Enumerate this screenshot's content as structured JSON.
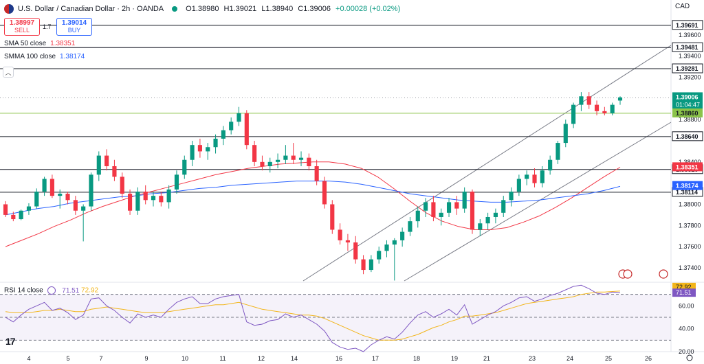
{
  "header": {
    "symbol": "U.S. Dollar / Canadian Dollar · 2h · OANDA",
    "open": "O1.38980",
    "high": "H1.39021",
    "low": "L1.38940",
    "close": "C1.39006",
    "change": "+0.00028 (+0.02%)"
  },
  "trade": {
    "sell_price": "1.38997",
    "sell_label": "SELL",
    "spread": "1.7",
    "buy_price": "1.39014",
    "buy_label": "BUY"
  },
  "indicators": {
    "sma_label": "SMA 50 close",
    "sma_value": "1.38351",
    "smma_label": "SMMA 100 close",
    "smma_value": "1.38174"
  },
  "currency": "CAD",
  "rsi": {
    "label": "RSI 14 close",
    "value": "71.51",
    "ma_value": "72.92"
  },
  "colors": {
    "up": "#089981",
    "down": "#f23645",
    "sma": "#f23645",
    "smma": "#2962ff",
    "rsi": "#7e57c2",
    "rsi_ma": "#f2b51a"
  },
  "chart_data": {
    "type": "candlestick",
    "x_ticks": [
      "4",
      "5",
      "7",
      "9",
      "10",
      "11",
      "12",
      "14",
      "16",
      "17",
      "18",
      "19",
      "21",
      "23",
      "24",
      "25",
      "26"
    ],
    "y_ticks": [
      "1.39600",
      "1.39400",
      "1.39200",
      "1.38800",
      "1.38400",
      "1.38000",
      "1.37800",
      "1.37600",
      "1.37400"
    ],
    "ylim": [
      1.3727,
      1.3993
    ],
    "last_price": "1.39006",
    "countdown": "01:04:47",
    "horizontal_levels": [
      {
        "label": "1.39691",
        "value": 1.39691,
        "color": "#131722"
      },
      {
        "label": "1.39481",
        "value": 1.39481,
        "color": "#131722"
      },
      {
        "label": "1.39281",
        "value": 1.39281,
        "color": "#131722"
      },
      {
        "label": "1.38860",
        "value": 1.3886,
        "color": "#8bc34a"
      },
      {
        "label": "1.38640",
        "value": 1.3864,
        "color": "#131722"
      },
      {
        "label": "1.38329",
        "value": 1.38329,
        "color": "#131722"
      },
      {
        "label": "1.38114",
        "value": 1.38114,
        "color": "#131722"
      }
    ],
    "price_tags": [
      {
        "label": "1.38351",
        "value": 1.38351,
        "color": "#f23645"
      },
      {
        "label": "1.38174",
        "value": 1.38174,
        "color": "#2962ff"
      }
    ],
    "series": [
      {
        "name": "SMA 50 close",
        "values": [
          1.376,
          1.3766,
          1.3772,
          1.3779,
          1.3785,
          1.3792,
          1.3798,
          1.3803,
          1.3808,
          1.3812,
          1.3816,
          1.382,
          1.3824,
          1.3828,
          1.3831,
          1.3834,
          1.3836,
          1.3838,
          1.3839,
          1.384,
          1.384,
          1.3838,
          1.3834,
          1.3826,
          1.3815,
          1.3803,
          1.3792,
          1.3784,
          1.3779,
          1.3776,
          1.3776,
          1.3778,
          1.3783,
          1.3789,
          1.3797,
          1.3806,
          1.3816,
          1.3826,
          1.3835
        ]
      },
      {
        "name": "SMMA 100 close",
        "values": [
          1.379,
          1.3793,
          1.3796,
          1.3798,
          1.3801,
          1.3803,
          1.3805,
          1.3807,
          1.3808,
          1.381,
          1.3811,
          1.3813,
          1.3815,
          1.3816,
          1.3818,
          1.3819,
          1.382,
          1.3821,
          1.3822,
          1.3822,
          1.3822,
          1.3821,
          1.3819,
          1.3816,
          1.3813,
          1.381,
          1.3808,
          1.3806,
          1.3804,
          1.3803,
          1.3802,
          1.3802,
          1.3803,
          1.3804,
          1.3806,
          1.3808,
          1.381,
          1.3813,
          1.3817
        ]
      },
      {
        "name": "USD/CAD",
        "candles": [
          [
            1.38,
            1.3803,
            1.3788,
            1.379
          ],
          [
            1.379,
            1.3793,
            1.3784,
            1.3786
          ],
          [
            1.3786,
            1.3795,
            1.3785,
            1.3794
          ],
          [
            1.3794,
            1.3801,
            1.379,
            1.3798
          ],
          [
            1.3798,
            1.3815,
            1.3796,
            1.3812
          ],
          [
            1.3812,
            1.3826,
            1.3808,
            1.3824
          ],
          [
            1.3824,
            1.3828,
            1.3806,
            1.3808
          ],
          [
            1.3808,
            1.3814,
            1.3796,
            1.381
          ],
          [
            1.381,
            1.3812,
            1.38,
            1.3804
          ],
          [
            1.3804,
            1.3808,
            1.379,
            1.3794
          ],
          [
            1.3794,
            1.38,
            1.3765,
            1.3798
          ],
          [
            1.3798,
            1.383,
            1.3794,
            1.3828
          ],
          [
            1.3828,
            1.385,
            1.3822,
            1.3846
          ],
          [
            1.3846,
            1.3852,
            1.3832,
            1.3836
          ],
          [
            1.3836,
            1.3842,
            1.3822,
            1.3826
          ],
          [
            1.3826,
            1.383,
            1.3806,
            1.381
          ],
          [
            1.381,
            1.3814,
            1.379,
            1.3794
          ],
          [
            1.3794,
            1.3816,
            1.379,
            1.3812
          ],
          [
            1.3812,
            1.3818,
            1.38,
            1.3804
          ],
          [
            1.3804,
            1.3812,
            1.3798,
            1.3808
          ],
          [
            1.3808,
            1.3812,
            1.3798,
            1.3802
          ],
          [
            1.3802,
            1.3818,
            1.3796,
            1.3814
          ],
          [
            1.3814,
            1.3832,
            1.381,
            1.3828
          ],
          [
            1.3828,
            1.3846,
            1.3824,
            1.3842
          ],
          [
            1.3842,
            1.386,
            1.3836,
            1.3856
          ],
          [
            1.3856,
            1.3862,
            1.3844,
            1.385
          ],
          [
            1.385,
            1.3858,
            1.3842,
            1.3854
          ],
          [
            1.3854,
            1.3866,
            1.3848,
            1.3862
          ],
          [
            1.3862,
            1.3874,
            1.3856,
            1.387
          ],
          [
            1.387,
            1.3882,
            1.3866,
            1.3878
          ],
          [
            1.3878,
            1.3892,
            1.3874,
            1.3886
          ],
          [
            1.3886,
            1.3889,
            1.3852,
            1.3856
          ],
          [
            1.3856,
            1.386,
            1.3836,
            1.384
          ],
          [
            1.384,
            1.3846,
            1.3832,
            1.3836
          ],
          [
            1.3836,
            1.3844,
            1.383,
            1.384
          ],
          [
            1.384,
            1.3848,
            1.3834,
            1.3842
          ],
          [
            1.3842,
            1.3856,
            1.3838,
            1.3846
          ],
          [
            1.3846,
            1.3858,
            1.3838,
            1.3842
          ],
          [
            1.3842,
            1.385,
            1.3836,
            1.3844
          ],
          [
            1.3844,
            1.3848,
            1.3832,
            1.3836
          ],
          [
            1.3836,
            1.3842,
            1.3818,
            1.3822
          ],
          [
            1.3822,
            1.3826,
            1.3796,
            1.38
          ],
          [
            1.38,
            1.3804,
            1.3772,
            1.3776
          ],
          [
            1.3776,
            1.3782,
            1.3762,
            1.3766
          ],
          [
            1.3766,
            1.3772,
            1.3756,
            1.3764
          ],
          [
            1.3764,
            1.377,
            1.3744,
            1.3748
          ],
          [
            1.3748,
            1.3752,
            1.3734,
            1.3738
          ],
          [
            1.3738,
            1.3752,
            1.3736,
            1.3748
          ],
          [
            1.3748,
            1.376,
            1.3744,
            1.3756
          ],
          [
            1.3756,
            1.3766,
            1.375,
            1.3762
          ],
          [
            1.3762,
            1.3768,
            1.3728,
            1.3766
          ],
          [
            1.3766,
            1.3778,
            1.376,
            1.3774
          ],
          [
            1.3774,
            1.3788,
            1.377,
            1.3784
          ],
          [
            1.3784,
            1.3798,
            1.3778,
            1.3794
          ],
          [
            1.3794,
            1.3806,
            1.3788,
            1.3802
          ],
          [
            1.3802,
            1.3808,
            1.3784,
            1.3788
          ],
          [
            1.3788,
            1.3796,
            1.378,
            1.3792
          ],
          [
            1.3792,
            1.3806,
            1.3788,
            1.3802
          ],
          [
            1.3802,
            1.3808,
            1.379,
            1.3796
          ],
          [
            1.3796,
            1.3816,
            1.3792,
            1.3812
          ],
          [
            1.3812,
            1.3814,
            1.3772,
            1.3776
          ],
          [
            1.3776,
            1.3786,
            1.377,
            1.3782
          ],
          [
            1.3782,
            1.3792,
            1.3776,
            1.3788
          ],
          [
            1.3788,
            1.3796,
            1.3782,
            1.3792
          ],
          [
            1.3792,
            1.3808,
            1.3788,
            1.3804
          ],
          [
            1.3804,
            1.3816,
            1.3798,
            1.3812
          ],
          [
            1.3812,
            1.3828,
            1.3808,
            1.3824
          ],
          [
            1.3824,
            1.3832,
            1.3818,
            1.3828
          ],
          [
            1.3828,
            1.3834,
            1.3816,
            1.382
          ],
          [
            1.382,
            1.3836,
            1.3816,
            1.3832
          ],
          [
            1.3832,
            1.3846,
            1.3828,
            1.3842
          ],
          [
            1.3842,
            1.386,
            1.3838,
            1.3858
          ],
          [
            1.3858,
            1.388,
            1.3854,
            1.3876
          ],
          [
            1.3876,
            1.3896,
            1.3872,
            1.3894
          ],
          [
            1.3894,
            1.3906,
            1.3888,
            1.3902
          ],
          [
            1.3902,
            1.3906,
            1.389,
            1.3894
          ],
          [
            1.3894,
            1.3898,
            1.3884,
            1.3888
          ],
          [
            1.3888,
            1.3892,
            1.3884,
            1.3886
          ],
          [
            1.3886,
            1.3896,
            1.3884,
            1.3894
          ],
          [
            1.3898,
            1.3902,
            1.3894,
            1.3901
          ]
        ]
      }
    ],
    "rsi": {
      "ylim": [
        20,
        80
      ],
      "levels": [
        70,
        50,
        30
      ],
      "y_ticks": [
        "60.00",
        "40.00",
        "20.00"
      ],
      "values": [
        50,
        46,
        52,
        57,
        60,
        63,
        56,
        58,
        54,
        48,
        52,
        66,
        67,
        60,
        56,
        50,
        45,
        53,
        50,
        52,
        50,
        57,
        63,
        66,
        68,
        62,
        62,
        66,
        68,
        69,
        70,
        46,
        43,
        44,
        47,
        48,
        53,
        50,
        52,
        48,
        44,
        38,
        28,
        24,
        22,
        23,
        20,
        26,
        30,
        33,
        31,
        37,
        45,
        52,
        55,
        50,
        53,
        57,
        52,
        61,
        44,
        48,
        52,
        55,
        60,
        63,
        67,
        68,
        64,
        66,
        69,
        71,
        74,
        77,
        78,
        75,
        71,
        70,
        72,
        71.51
      ],
      "ma_values": [
        55,
        54,
        54,
        54,
        55,
        56,
        56,
        57,
        56,
        55,
        55,
        57,
        58,
        59,
        58,
        57,
        56,
        55,
        54,
        54,
        54,
        55,
        56,
        57,
        58,
        59,
        60,
        61,
        61,
        62,
        63,
        61,
        59,
        57,
        56,
        55,
        54,
        53,
        52,
        52,
        51,
        49,
        46,
        43,
        40,
        37,
        34,
        32,
        30,
        30,
        30,
        31,
        33,
        35,
        38,
        41,
        43,
        46,
        48,
        51,
        51,
        52,
        53,
        54,
        56,
        58,
        60,
        62,
        63,
        64,
        65,
        66,
        67,
        68,
        70,
        71,
        72,
        72,
        72.5,
        72.92
      ]
    }
  }
}
